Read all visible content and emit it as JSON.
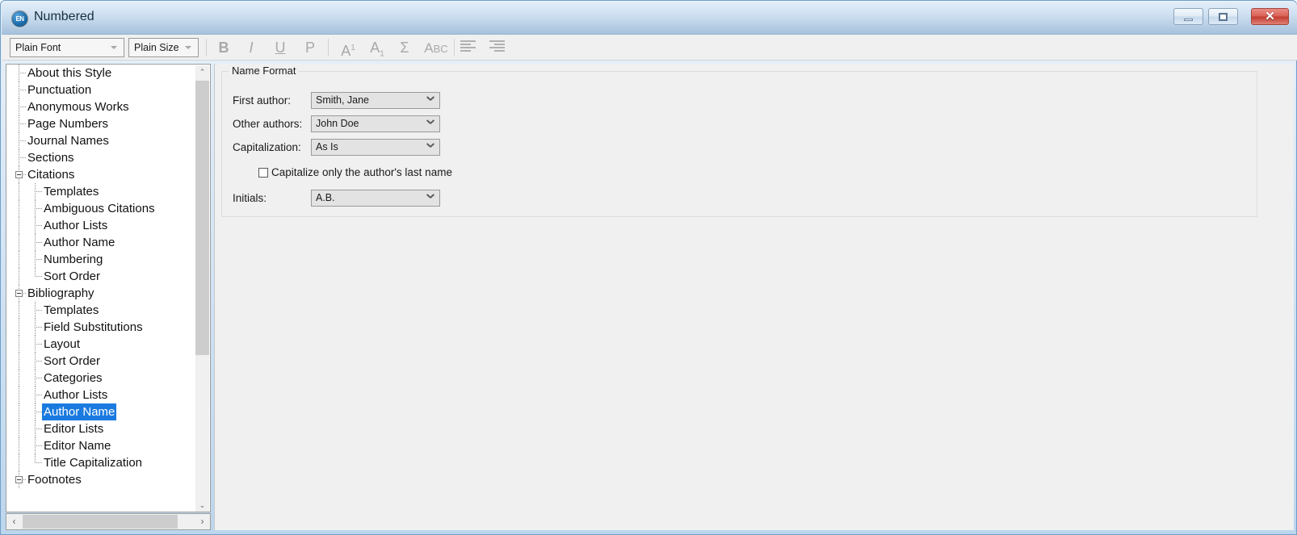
{
  "window": {
    "title": "Numbered",
    "app_icon": "EN",
    "controls": {
      "minimize": "minimize-button",
      "maximize": "maximize-button",
      "close_glyph": "✕"
    }
  },
  "toolbar": {
    "font_combo": {
      "value": "Plain Font"
    },
    "size_combo": {
      "value": "Plain Size"
    },
    "buttons": [
      {
        "name": "bold-button",
        "glyph": "B",
        "style": "bold"
      },
      {
        "name": "italic-button",
        "glyph": "I",
        "style": "italic"
      },
      {
        "name": "underline-button",
        "glyph": "U",
        "style": "underline"
      },
      {
        "name": "plain-button",
        "glyph": "P",
        "style": "plain"
      },
      {
        "name": "superscript-button",
        "glyph": "A",
        "style": "sup",
        "affix": "1"
      },
      {
        "name": "subscript-button",
        "glyph": "A",
        "style": "sub",
        "affix": "1"
      },
      {
        "name": "symbol-button",
        "glyph": "Σ",
        "style": "plain"
      },
      {
        "name": "spellcheck-button",
        "glyph": "A",
        "style": "abc",
        "affix": "BC"
      },
      {
        "name": "align-left-button",
        "glyph": "",
        "style": "align"
      },
      {
        "name": "align-right-button",
        "glyph": "",
        "style": "align"
      }
    ]
  },
  "tree": {
    "nodes": [
      {
        "label": "About this Style",
        "depth": 0,
        "expander": false,
        "selected": false
      },
      {
        "label": "Punctuation",
        "depth": 0,
        "expander": false,
        "selected": false
      },
      {
        "label": "Anonymous Works",
        "depth": 0,
        "expander": false,
        "selected": false
      },
      {
        "label": "Page Numbers",
        "depth": 0,
        "expander": false,
        "selected": false
      },
      {
        "label": "Journal Names",
        "depth": 0,
        "expander": false,
        "selected": false
      },
      {
        "label": "Sections",
        "depth": 0,
        "expander": false,
        "selected": false
      },
      {
        "label": "Citations",
        "depth": 0,
        "expander": true,
        "selected": false
      },
      {
        "label": "Templates",
        "depth": 1,
        "expander": false,
        "selected": false
      },
      {
        "label": "Ambiguous Citations",
        "depth": 1,
        "expander": false,
        "selected": false
      },
      {
        "label": "Author Lists",
        "depth": 1,
        "expander": false,
        "selected": false
      },
      {
        "label": "Author Name",
        "depth": 1,
        "expander": false,
        "selected": false
      },
      {
        "label": "Numbering",
        "depth": 1,
        "expander": false,
        "selected": false
      },
      {
        "label": "Sort Order",
        "depth": 1,
        "expander": false,
        "selected": false
      },
      {
        "label": "Bibliography",
        "depth": 0,
        "expander": true,
        "selected": false
      },
      {
        "label": "Templates",
        "depth": 1,
        "expander": false,
        "selected": false
      },
      {
        "label": "Field Substitutions",
        "depth": 1,
        "expander": false,
        "selected": false
      },
      {
        "label": "Layout",
        "depth": 1,
        "expander": false,
        "selected": false
      },
      {
        "label": "Sort Order",
        "depth": 1,
        "expander": false,
        "selected": false
      },
      {
        "label": "Categories",
        "depth": 1,
        "expander": false,
        "selected": false
      },
      {
        "label": "Author Lists",
        "depth": 1,
        "expander": false,
        "selected": false
      },
      {
        "label": "Author Name",
        "depth": 1,
        "expander": false,
        "selected": true
      },
      {
        "label": "Editor Lists",
        "depth": 1,
        "expander": false,
        "selected": false
      },
      {
        "label": "Editor Name",
        "depth": 1,
        "expander": false,
        "selected": false
      },
      {
        "label": "Title Capitalization",
        "depth": 1,
        "expander": false,
        "selected": false
      },
      {
        "label": "Footnotes",
        "depth": 0,
        "expander": true,
        "selected": false
      }
    ],
    "selection_color": "#1a7ae0",
    "scrollbar": {
      "up_arrow": "⌃",
      "down_arrow": "⌄",
      "left_arrow": "‹",
      "right_arrow": "›"
    }
  },
  "form": {
    "group_title": "Name Format",
    "rows": [
      {
        "label": "First author:",
        "value": "Smith, Jane",
        "name": "first-author"
      },
      {
        "label": "Other authors:",
        "value": "John Doe",
        "name": "other-authors"
      },
      {
        "label": "Capitalization:",
        "value": "As Is",
        "name": "capitalization"
      }
    ],
    "checkbox": {
      "label": "Capitalize only the author's last name",
      "checked": false
    },
    "initials": {
      "label": "Initials:",
      "value": "A.B."
    }
  }
}
